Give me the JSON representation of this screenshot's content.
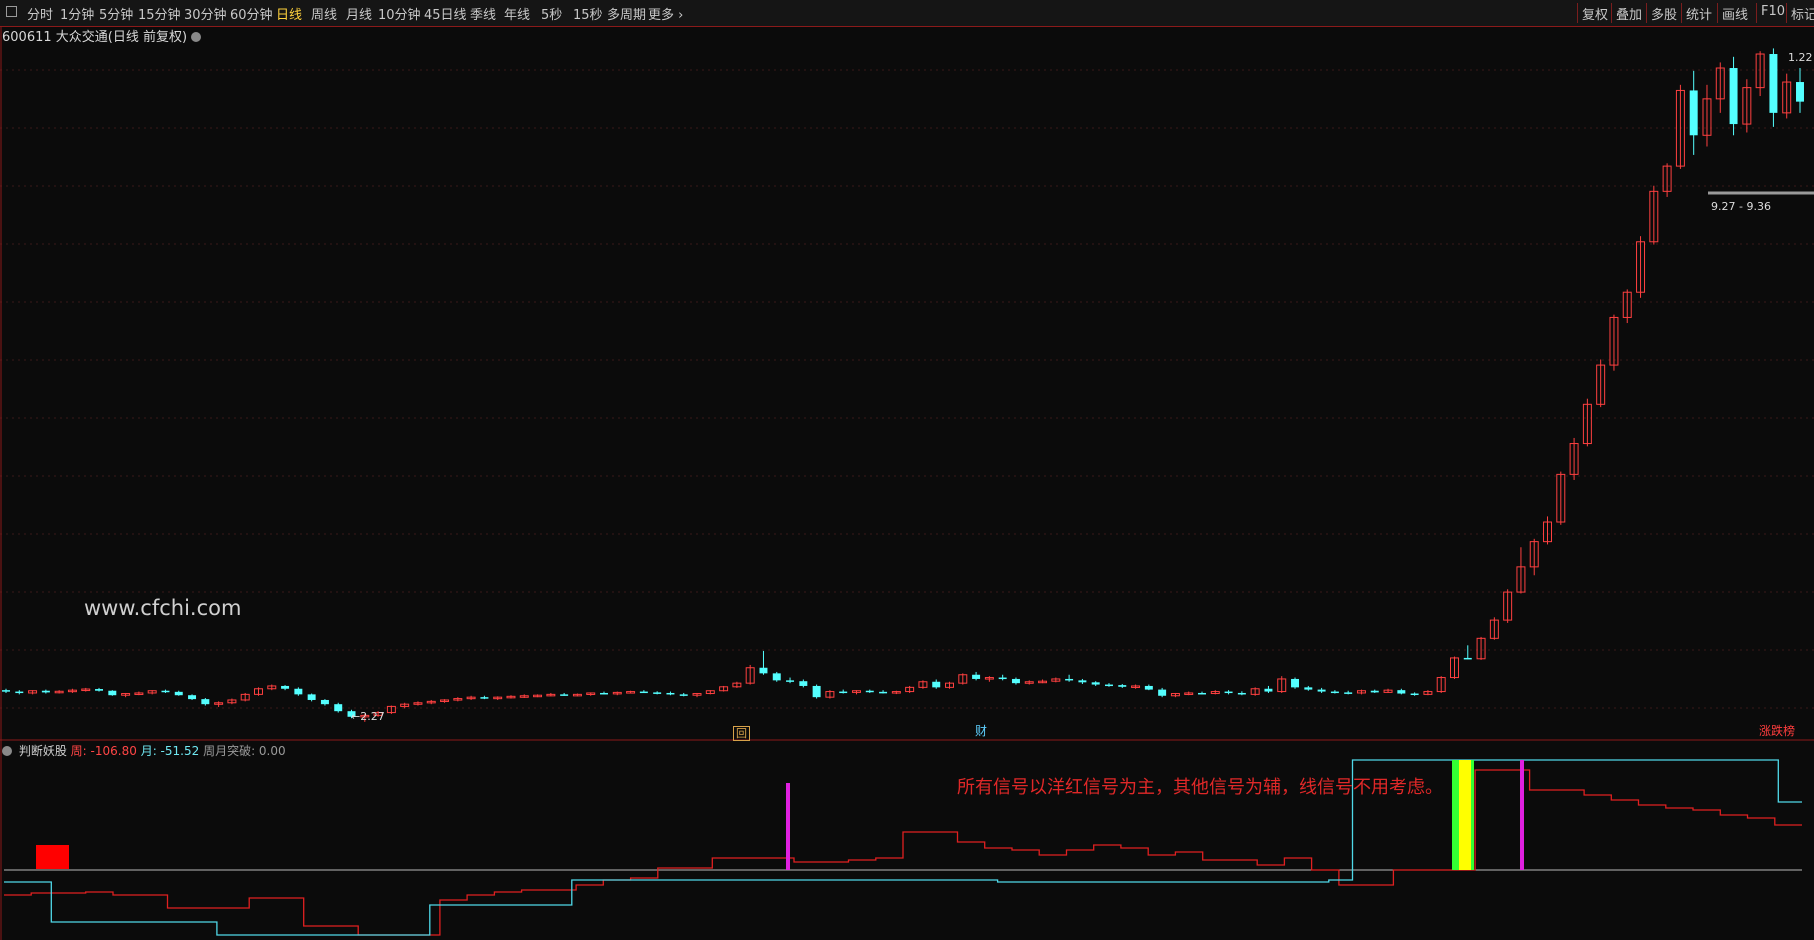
{
  "toolbar": {
    "periods": [
      "分时",
      "1分钟",
      "5分钟",
      "15分钟",
      "30分钟",
      "60分钟",
      "日线",
      "周线",
      "月线",
      "10分钟",
      "45日线",
      "季线",
      "年线",
      "5秒",
      "15秒",
      "多周期",
      "更多 ›"
    ],
    "active_period": "日线",
    "right_buttons": [
      "复权",
      "叠加",
      "多股",
      "统计",
      "画线",
      "F10",
      "标记"
    ]
  },
  "stock": {
    "label": "600611 大众交通(日线 前复权)",
    "low_label": "←2.27",
    "high_label": "1.22",
    "range_label": "9.27 - 9.36"
  },
  "watermark": "www.cfchi.com",
  "badges": {
    "o": "回",
    "c": "财",
    "z": "涨跌榜"
  },
  "indicator": {
    "name": "判断妖股",
    "week_label": "周: -106.80",
    "month_label": "月: -51.52",
    "breakout_label": "周月突破: 0.00",
    "note": "所有信号以洋红信号为主，其他信号为辅，线信号不用考虑。"
  },
  "colors": {
    "up": "#ff4040",
    "down": "#54ffff",
    "week_line": "#e02020",
    "month_line": "#4fd8e8",
    "magenta": "#e020e0",
    "yellow": "#ffff00",
    "green": "#33ff33"
  },
  "chart_data": {
    "type": "candlestick",
    "candles_ohlc": [
      [
        3.4,
        3.45,
        3.3,
        3.35
      ],
      [
        3.35,
        3.4,
        3.25,
        3.3
      ],
      [
        3.3,
        3.4,
        3.25,
        3.38
      ],
      [
        3.38,
        3.42,
        3.28,
        3.32
      ],
      [
        3.32,
        3.4,
        3.28,
        3.36
      ],
      [
        3.36,
        3.45,
        3.3,
        3.4
      ],
      [
        3.4,
        3.48,
        3.35,
        3.44
      ],
      [
        3.44,
        3.48,
        3.35,
        3.38
      ],
      [
        3.38,
        3.4,
        3.2,
        3.22
      ],
      [
        3.22,
        3.3,
        3.15,
        3.28
      ],
      [
        3.28,
        3.35,
        3.22,
        3.3
      ],
      [
        3.3,
        3.4,
        3.25,
        3.38
      ],
      [
        3.38,
        3.42,
        3.3,
        3.34
      ],
      [
        3.34,
        3.38,
        3.2,
        3.22
      ],
      [
        3.22,
        3.25,
        3.05,
        3.08
      ],
      [
        3.08,
        3.12,
        2.85,
        2.9
      ],
      [
        2.9,
        3.0,
        2.8,
        2.95
      ],
      [
        2.95,
        3.1,
        2.9,
        3.05
      ],
      [
        3.05,
        3.3,
        3.0,
        3.25
      ],
      [
        3.25,
        3.5,
        3.2,
        3.45
      ],
      [
        3.45,
        3.6,
        3.4,
        3.55
      ],
      [
        3.55,
        3.58,
        3.4,
        3.45
      ],
      [
        3.45,
        3.5,
        3.2,
        3.25
      ],
      [
        3.25,
        3.28,
        3.0,
        3.05
      ],
      [
        3.05,
        3.08,
        2.85,
        2.9
      ],
      [
        2.9,
        2.95,
        2.6,
        2.65
      ],
      [
        2.65,
        2.7,
        2.4,
        2.45
      ],
      [
        2.45,
        2.55,
        2.27,
        2.5
      ],
      [
        2.5,
        2.65,
        2.45,
        2.6
      ],
      [
        2.6,
        2.85,
        2.55,
        2.82
      ],
      [
        2.82,
        2.95,
        2.75,
        2.9
      ],
      [
        2.9,
        3.0,
        2.85,
        2.95
      ],
      [
        2.95,
        3.05,
        2.9,
        3.0
      ],
      [
        3.0,
        3.08,
        2.95,
        3.05
      ],
      [
        3.05,
        3.15,
        3.0,
        3.1
      ],
      [
        3.1,
        3.2,
        3.05,
        3.15
      ],
      [
        3.15,
        3.2,
        3.08,
        3.12
      ],
      [
        3.12,
        3.18,
        3.05,
        3.15
      ],
      [
        3.15,
        3.22,
        3.1,
        3.18
      ],
      [
        3.18,
        3.25,
        3.12,
        3.2
      ],
      [
        3.2,
        3.25,
        3.15,
        3.22
      ],
      [
        3.22,
        3.3,
        3.18,
        3.25
      ],
      [
        3.25,
        3.3,
        3.2,
        3.22
      ],
      [
        3.22,
        3.28,
        3.18,
        3.25
      ],
      [
        3.25,
        3.32,
        3.2,
        3.3
      ],
      [
        3.3,
        3.35,
        3.25,
        3.28
      ],
      [
        3.28,
        3.35,
        3.22,
        3.32
      ],
      [
        3.32,
        3.38,
        3.28,
        3.35
      ],
      [
        3.35,
        3.4,
        3.3,
        3.32
      ],
      [
        3.32,
        3.36,
        3.25,
        3.3
      ],
      [
        3.3,
        3.35,
        3.22,
        3.25
      ],
      [
        3.25,
        3.3,
        3.18,
        3.22
      ],
      [
        3.22,
        3.3,
        3.15,
        3.28
      ],
      [
        3.28,
        3.4,
        3.25,
        3.38
      ],
      [
        3.38,
        3.55,
        3.35,
        3.52
      ],
      [
        3.52,
        3.7,
        3.48,
        3.65
      ],
      [
        3.65,
        4.3,
        3.6,
        4.2
      ],
      [
        4.2,
        4.8,
        3.95,
        4.0
      ],
      [
        4.0,
        4.05,
        3.7,
        3.75
      ],
      [
        3.75,
        3.85,
        3.65,
        3.72
      ],
      [
        3.72,
        3.78,
        3.5,
        3.55
      ],
      [
        3.55,
        3.6,
        3.1,
        3.15
      ],
      [
        3.15,
        3.4,
        3.1,
        3.35
      ],
      [
        3.35,
        3.42,
        3.28,
        3.32
      ],
      [
        3.32,
        3.4,
        3.25,
        3.38
      ],
      [
        3.38,
        3.42,
        3.3,
        3.34
      ],
      [
        3.34,
        3.4,
        3.28,
        3.32
      ],
      [
        3.32,
        3.38,
        3.26,
        3.35
      ],
      [
        3.35,
        3.55,
        3.3,
        3.5
      ],
      [
        3.5,
        3.75,
        3.45,
        3.7
      ],
      [
        3.7,
        3.78,
        3.45,
        3.5
      ],
      [
        3.5,
        3.7,
        3.45,
        3.65
      ],
      [
        3.65,
        4.0,
        3.6,
        3.95
      ],
      [
        3.95,
        4.05,
        3.75,
        3.8
      ],
      [
        3.8,
        3.9,
        3.7,
        3.85
      ],
      [
        3.85,
        3.95,
        3.75,
        3.8
      ],
      [
        3.8,
        3.85,
        3.6,
        3.65
      ],
      [
        3.65,
        3.75,
        3.6,
        3.7
      ],
      [
        3.7,
        3.78,
        3.65,
        3.72
      ],
      [
        3.72,
        3.85,
        3.68,
        3.8
      ],
      [
        3.8,
        3.95,
        3.7,
        3.75
      ],
      [
        3.75,
        3.8,
        3.62,
        3.68
      ],
      [
        3.68,
        3.72,
        3.55,
        3.6
      ],
      [
        3.6,
        3.65,
        3.52,
        3.58
      ],
      [
        3.58,
        3.62,
        3.48,
        3.52
      ],
      [
        3.52,
        3.6,
        3.45,
        3.55
      ],
      [
        3.55,
        3.6,
        3.4,
        3.42
      ],
      [
        3.42,
        3.48,
        3.15,
        3.2
      ],
      [
        3.2,
        3.3,
        3.15,
        3.28
      ],
      [
        3.28,
        3.35,
        3.22,
        3.3
      ],
      [
        3.3,
        3.35,
        3.25,
        3.28
      ],
      [
        3.28,
        3.4,
        3.25,
        3.35
      ],
      [
        3.35,
        3.4,
        3.25,
        3.3
      ],
      [
        3.3,
        3.36,
        3.22,
        3.25
      ],
      [
        3.25,
        3.5,
        3.2,
        3.45
      ],
      [
        3.45,
        3.55,
        3.3,
        3.35
      ],
      [
        3.35,
        3.9,
        3.3,
        3.8
      ],
      [
        3.8,
        3.85,
        3.45,
        3.5
      ],
      [
        3.5,
        3.55,
        3.38,
        3.42
      ],
      [
        3.42,
        3.48,
        3.3,
        3.35
      ],
      [
        3.35,
        3.4,
        3.28,
        3.32
      ],
      [
        3.32,
        3.38,
        3.25,
        3.3
      ],
      [
        3.3,
        3.42,
        3.25,
        3.38
      ],
      [
        3.38,
        3.42,
        3.3,
        3.32
      ],
      [
        3.32,
        3.45,
        3.3,
        3.4
      ],
      [
        3.4,
        3.45,
        3.25,
        3.28
      ],
      [
        3.28,
        3.32,
        3.2,
        3.25
      ],
      [
        3.25,
        3.4,
        3.22,
        3.35
      ],
      [
        3.35,
        3.9,
        3.3,
        3.85
      ],
      [
        3.85,
        4.6,
        3.8,
        4.55
      ],
      [
        4.55,
        5.0,
        4.5,
        4.52
      ],
      [
        4.52,
        5.3,
        4.48,
        5.25
      ],
      [
        5.25,
        6.0,
        5.2,
        5.9
      ],
      [
        5.9,
        7.0,
        5.8,
        6.9
      ],
      [
        6.9,
        8.5,
        6.85,
        7.8
      ],
      [
        7.8,
        8.8,
        7.5,
        8.7
      ],
      [
        8.7,
        9.6,
        8.6,
        9.4
      ],
      [
        9.4,
        11.2,
        9.3,
        11.1
      ],
      [
        11.1,
        12.4,
        10.9,
        12.2
      ],
      [
        12.2,
        13.8,
        12.1,
        13.6
      ],
      [
        13.6,
        15.2,
        13.5,
        15.0
      ],
      [
        15.0,
        16.8,
        14.8,
        16.7
      ],
      [
        16.7,
        17.7,
        16.5,
        17.6
      ],
      [
        17.6,
        19.6,
        17.4,
        19.4
      ],
      [
        19.4,
        21.4,
        19.3,
        21.2
      ],
      [
        21.2,
        22.2,
        21.0,
        22.1
      ],
      [
        22.1,
        25.0,
        22.0,
        24.8
      ],
      [
        24.8,
        25.5,
        22.5,
        23.2
      ],
      [
        23.2,
        25.0,
        22.8,
        24.5
      ],
      [
        24.5,
        25.8,
        24.0,
        25.6
      ],
      [
        25.6,
        26.0,
        23.2,
        23.6
      ],
      [
        23.6,
        25.2,
        23.3,
        24.9
      ],
      [
        24.9,
        26.2,
        24.6,
        26.1
      ],
      [
        26.1,
        26.3,
        23.5,
        24.0
      ],
      [
        24.0,
        25.4,
        23.8,
        25.1
      ],
      [
        25.1,
        25.6,
        24.0,
        24.4
      ]
    ],
    "indicator_week": [
      -45,
      -45,
      -46,
      -46,
      -46,
      -47,
      -47,
      -48,
      -48,
      -48,
      -48,
      -50,
      -50,
      -50,
      -50,
      -52,
      -52,
      -52,
      -55,
      -58,
      -60,
      -60,
      -62,
      -62,
      -62,
      -62,
      -62,
      -66,
      -66,
      -68,
      -70,
      -74,
      -76,
      -76,
      -78,
      -78,
      -80,
      -80,
      -82,
      -82,
      -84,
      -84,
      -86,
      -88,
      -88,
      -90,
      -90,
      -92,
      -92,
      -94,
      -94,
      -94,
      -100,
      -106.8
    ],
    "indicator_month": [
      -20,
      -20,
      -30,
      -30,
      -30,
      -30,
      -30,
      -30,
      -30,
      -30,
      -30,
      -30,
      -30,
      -32,
      -32,
      -34,
      -36,
      -38,
      -38,
      -40,
      -40,
      -40,
      -42,
      -42,
      -44,
      -46,
      -46,
      -48,
      -48,
      -48,
      -48,
      -50,
      -50,
      -50,
      -50,
      -51.52
    ]
  }
}
